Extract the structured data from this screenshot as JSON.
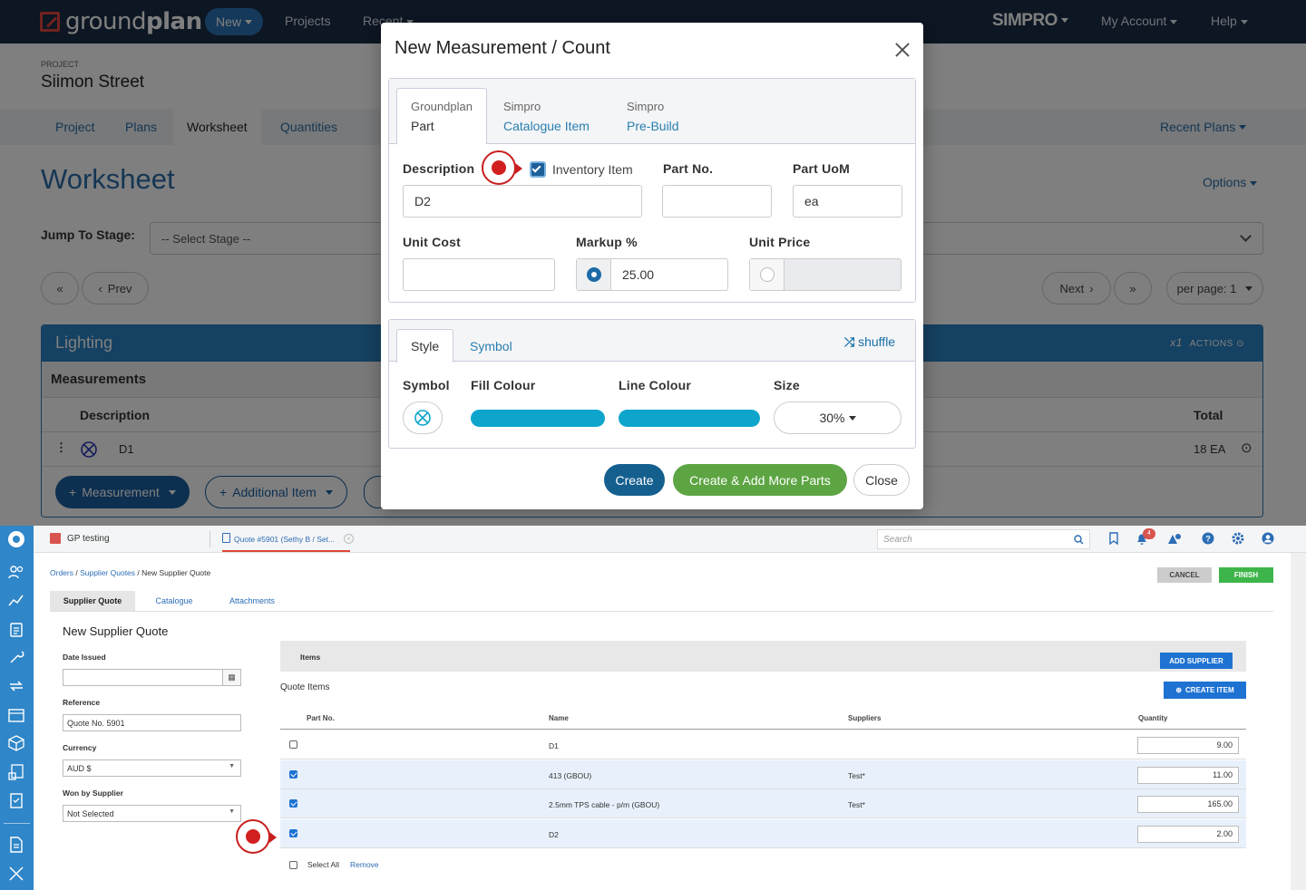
{
  "groundplan": {
    "logo": {
      "light": "ground",
      "bold": "plan"
    },
    "nav": {
      "new_label": "New",
      "projects_label": "Projects",
      "recent_label": "Recent",
      "simpro_label": "SIMPRO",
      "my_account_label": "My Account",
      "help_label": "Help"
    },
    "project_label": "PROJECT",
    "project_name": "Siimon Street",
    "tabs": [
      "Project",
      "Plans",
      "Worksheet",
      "Quantities"
    ],
    "recent_plans_label": "Recent Plans",
    "page_title": "Worksheet",
    "options_label": "Options",
    "jump_label": "Jump To Stage:",
    "stage_select_value": "-- Select Stage --",
    "pager": {
      "prev_label": "Prev",
      "next_label": "Next",
      "per_page_label": "per page: 1"
    },
    "panel": {
      "title": "Lighting",
      "multiplier": "x1",
      "actions_label": "ACTIONS",
      "measurements_label": "Measurements",
      "col_description": "Description",
      "col_total": "Total",
      "row": {
        "description": "D1",
        "total": "18 EA"
      },
      "measurement_btn": "Measurement",
      "additional_item_btn": "Additional Item"
    },
    "modal": {
      "title": "New Measurement / Count",
      "tabs": [
        {
          "small": "Groundplan",
          "label": "Part"
        },
        {
          "small": "Simpro",
          "label": "Catalogue Item"
        },
        {
          "small": "Simpro",
          "label": "Pre-Build"
        }
      ],
      "description_label": "Description",
      "inventory_item_label": "Inventory Item",
      "inventory_item_checked": true,
      "part_no_label": "Part No.",
      "part_uom_label": "Part UoM",
      "description_value": "D2",
      "part_no_value": "",
      "part_uom_value": "ea",
      "unit_cost_label": "Unit Cost",
      "markup_label": "Markup %",
      "unit_price_label": "Unit Price",
      "unit_cost_value": "",
      "markup_value": "25.00",
      "unit_price_value": "",
      "style_tabs": [
        "Style",
        "Symbol"
      ],
      "shuffle_label": "shuffle",
      "symbol_label": "Symbol",
      "fill_colour_label": "Fill Colour",
      "line_colour_label": "Line Colour",
      "size_label": "Size",
      "size_value": "30%",
      "fill_colour": "#0ea5cc",
      "line_colour": "#0ea5cc",
      "create_btn": "Create",
      "create_add_btn": "Create & Add More Parts",
      "close_btn": "Close"
    }
  },
  "simpro": {
    "tabs_top": {
      "company": "GP testing",
      "quote_tab": "Quote #5901 (Sethy B / Set..."
    },
    "search_placeholder": "Search",
    "notification_count": "4",
    "breadcrumb": {
      "orders": "Orders",
      "supplier_quotes": "Supplier Quotes",
      "current": "New Supplier Quote"
    },
    "cancel_btn": "CANCEL",
    "finish_btn": "FINISH",
    "subtabs": [
      "Supplier Quote",
      "Catalogue",
      "Attachments"
    ],
    "form_title": "New Supplier Quote",
    "date_issued_label": "Date Issued",
    "date_issued_value": "",
    "reference_label": "Reference",
    "reference_value": "Quote No. 5901",
    "currency_label": "Currency",
    "currency_value": "AUD $",
    "won_by_label": "Won by Supplier",
    "won_by_value": "Not Selected",
    "items_header": "Items",
    "add_supplier_btn": "ADD SUPPLIER",
    "quote_items_label": "Quote Items",
    "create_item_btn": "CREATE ITEM",
    "columns": [
      "Part No.",
      "Name",
      "Suppliers",
      "Quantity"
    ],
    "rows": [
      {
        "checked": false,
        "part_no": "",
        "name": "D1",
        "suppliers": "",
        "quantity": "9.00"
      },
      {
        "checked": true,
        "part_no": "",
        "name": "413 (GBOU)",
        "suppliers": "Test*",
        "quantity": "11.00"
      },
      {
        "checked": true,
        "part_no": "",
        "name": "2.5mm TPS cable - p/m (GBOU)",
        "suppliers": "Test*",
        "quantity": "165.00"
      },
      {
        "checked": true,
        "part_no": "",
        "name": "D2",
        "suppliers": "",
        "quantity": "2.00"
      }
    ],
    "select_all_label": "Select All",
    "remove_label": "Remove"
  }
}
